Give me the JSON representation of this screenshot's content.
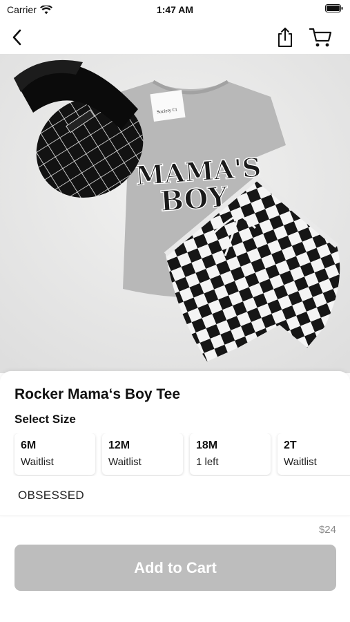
{
  "status_bar": {
    "carrier": "Carrier",
    "time": "1:47 AM"
  },
  "nav": {
    "back_icon": "chevron-left-icon",
    "share_icon": "share-icon",
    "cart_icon": "cart-icon"
  },
  "product": {
    "title": "Rocker Mama‘s Boy Tee",
    "size_heading": "Select Size",
    "sizes": [
      {
        "label": "6M",
        "availability": "Waitlist"
      },
      {
        "label": "12M",
        "availability": "Waitlist"
      },
      {
        "label": "18M",
        "availability": "1 left"
      },
      {
        "label": "2T",
        "availability": "Waitlist"
      }
    ],
    "brand": "OBSESSED",
    "image": {
      "shirt_text_line1": "MAMA'S",
      "shirt_text_line2": "BOY",
      "tag_text": "Society Ct"
    }
  },
  "footer": {
    "price": "$24",
    "add_to_cart_label": "Add to Cart"
  },
  "colors": {
    "button_disabled": "#bdbdbd",
    "price_text": "#8a8a8a",
    "background": "#ffffff"
  }
}
